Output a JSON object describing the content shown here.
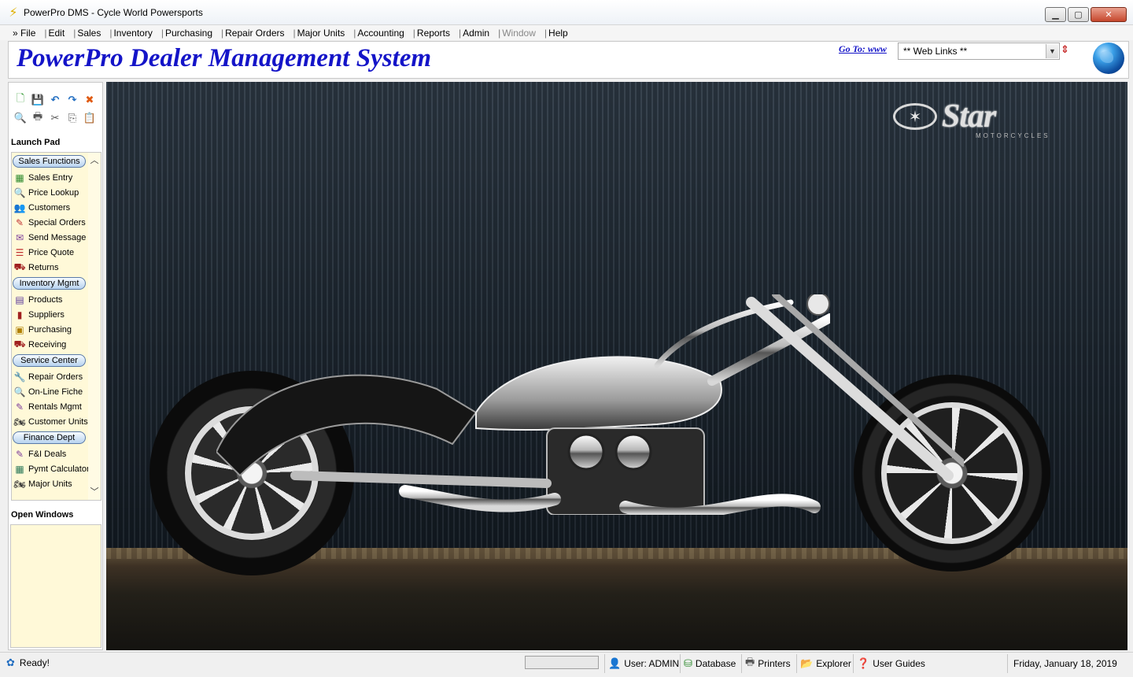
{
  "window": {
    "title": "PowerPro DMS - Cycle World Powersports",
    "app_icon": "lightning-icon",
    "controls": [
      "minimize",
      "maximize",
      "close"
    ]
  },
  "menu": [
    {
      "label": "File",
      "prefix": "»",
      "disabled": false
    },
    {
      "label": "Edit",
      "disabled": false
    },
    {
      "label": "Sales",
      "disabled": false
    },
    {
      "label": "Inventory",
      "disabled": false
    },
    {
      "label": "Purchasing",
      "disabled": false
    },
    {
      "label": "Repair Orders",
      "disabled": false
    },
    {
      "label": "Major Units",
      "disabled": false
    },
    {
      "label": "Accounting",
      "disabled": false
    },
    {
      "label": "Reports",
      "disabled": false
    },
    {
      "label": "Admin",
      "disabled": false
    },
    {
      "label": "Window",
      "disabled": true
    },
    {
      "label": "Help",
      "disabled": false
    }
  ],
  "header": {
    "title": "PowerPro Dealer Management System",
    "goto_label": "Go To: www",
    "weblinks_value": "** Web Links **",
    "title_color": "#1414c8"
  },
  "toolbar": {
    "row1": [
      "new-icon",
      "save-icon",
      "undo-icon",
      "redo-icon",
      "delete-icon"
    ],
    "row2": [
      "preview-icon",
      "print-icon",
      "cut-icon",
      "copy-icon",
      "paste-icon"
    ]
  },
  "launch_pad": {
    "label": "Launch Pad",
    "groups": [
      {
        "label": "Sales Functions",
        "items": [
          {
            "label": "Sales Entry",
            "icon": "cash-register-icon"
          },
          {
            "label": "Price Lookup",
            "icon": "magnifier-icon"
          },
          {
            "label": "Customers",
            "icon": "people-icon"
          },
          {
            "label": "Special Orders",
            "icon": "order-icon"
          },
          {
            "label": "Send Message",
            "icon": "message-icon"
          },
          {
            "label": "Price Quote",
            "icon": "quote-icon"
          },
          {
            "label": "Returns",
            "icon": "truck-icon"
          }
        ]
      },
      {
        "label": "Inventory Mgmt",
        "items": [
          {
            "label": "Products",
            "icon": "products-icon"
          },
          {
            "label": "Suppliers",
            "icon": "suppliers-icon"
          },
          {
            "label": "Purchasing",
            "icon": "purchase-order-icon"
          },
          {
            "label": "Receiving",
            "icon": "receiving-icon"
          }
        ]
      },
      {
        "label": "Service Center",
        "items": [
          {
            "label": "Repair Orders",
            "icon": "wrench-icon"
          },
          {
            "label": "On-Line Fiche",
            "icon": "magnifier-icon"
          },
          {
            "label": "Rentals Mgmt",
            "icon": "rentals-icon"
          },
          {
            "label": "Customer Units",
            "icon": "motorcycle-icon"
          }
        ]
      },
      {
        "label": "Finance Dept",
        "items": [
          {
            "label": "F&I Deals",
            "icon": "deals-icon"
          },
          {
            "label": "Pymt Calculator",
            "icon": "calculator-icon"
          },
          {
            "label": "Major Units",
            "icon": "motorcycle-icon"
          }
        ]
      }
    ]
  },
  "open_windows": {
    "label": "Open Windows"
  },
  "banner": {
    "brand_name": "Star",
    "brand_sub": "MOTORCYCLES"
  },
  "status": {
    "ready_text": "Ready!",
    "user": "User: ADMIN",
    "database": "Database",
    "printers": "Printers",
    "explorer": "Explorer",
    "user_guides": "User Guides",
    "date": "Friday, January 18, 2019"
  }
}
